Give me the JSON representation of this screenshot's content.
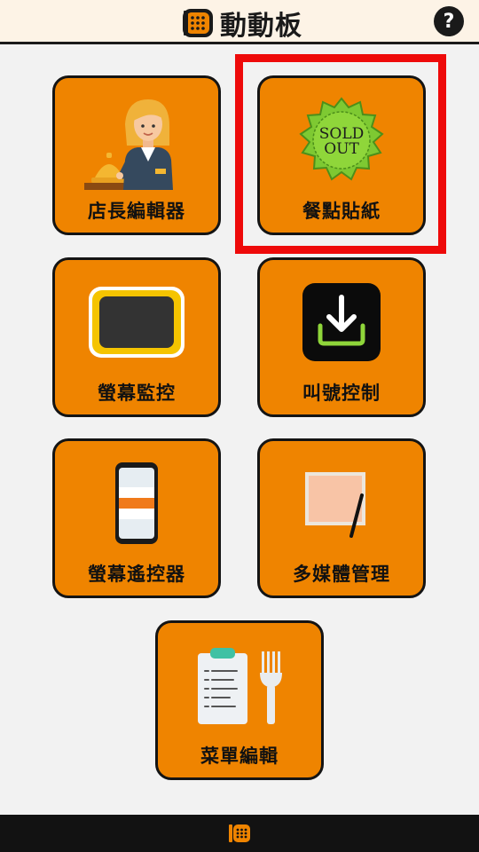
{
  "header": {
    "title": "動動板",
    "logo_icon": "dotmatrix-board-logo-icon",
    "help_label": "?"
  },
  "tiles": [
    {
      "label": "店長編輯器",
      "icon": "shopkeeper-bell-icon"
    },
    {
      "label": "餐點貼紙",
      "icon": "sold-out-sticker-icon",
      "sticker_line1": "SOLD",
      "sticker_line2": "OUT"
    },
    {
      "label": "螢幕監控",
      "icon": "screen-monitor-icon"
    },
    {
      "label": "叫號控制",
      "icon": "download-tray-icon"
    },
    {
      "label": "螢幕遙控器",
      "icon": "phone-remote-icon"
    },
    {
      "label": "多媒體管理",
      "icon": "media-canvas-icon"
    },
    {
      "label": "菜單編輯",
      "icon": "menu-clipboard-fork-icon"
    }
  ],
  "highlight": {
    "target": "餐點貼紙",
    "color": "#ee0a0a"
  },
  "colors": {
    "tile": "#ef8400",
    "border": "#141414",
    "background": "#f2f2f2",
    "header": "#fdf3e6",
    "bottom_bar": "#121212"
  },
  "bottom_bar": {
    "logo_icon": "dotmatrix-board-logo-icon"
  }
}
